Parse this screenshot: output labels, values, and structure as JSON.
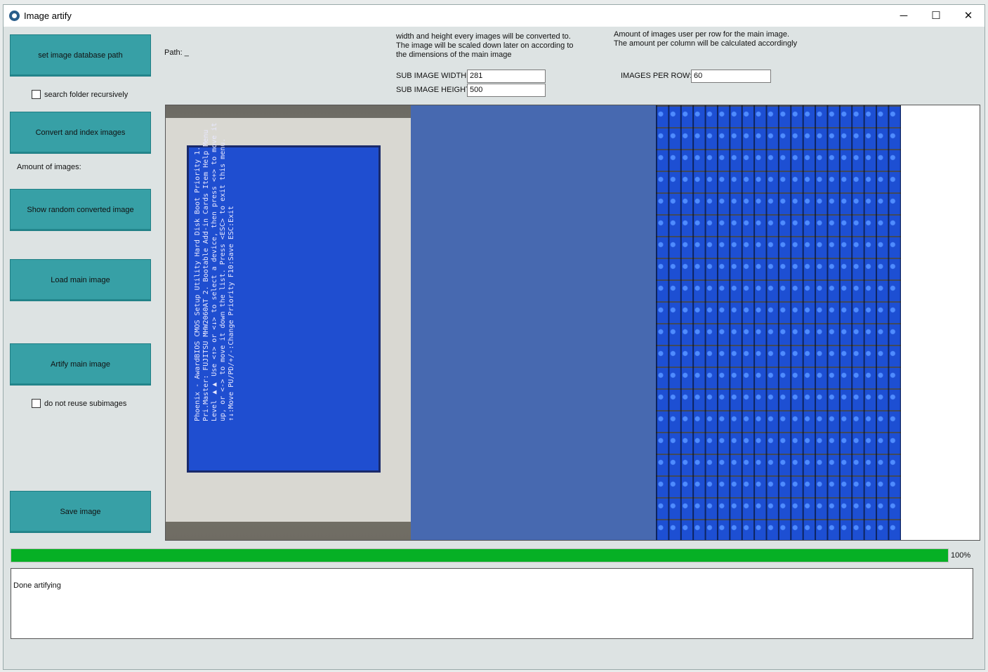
{
  "window": {
    "title": "Image artify",
    "minimize_glyph": "─",
    "maximize_glyph": "☐",
    "close_glyph": "✕"
  },
  "sidebar": {
    "set_path_button": "set image database path",
    "search_recursive_label": "search folder recursively",
    "search_recursive_checked": false,
    "convert_button": "Convert and index images",
    "amount_label": "Amount of images:",
    "show_random_button": "Show random converted image",
    "load_main_button": "Load main image",
    "artify_button": "Artify main image",
    "no_reuse_label": "do not reuse subimages",
    "no_reuse_checked": false,
    "save_button": "Save image"
  },
  "settings": {
    "path_label": "Path: _",
    "size_info_line1": "width and height every images will be converted to.",
    "size_info_line2": "The image will be scaled down later on according to",
    "size_info_line3": "the dimensions of the main image",
    "sub_width_label": "SUB IMAGE WIDTH:",
    "sub_width_value": "281",
    "sub_height_label": "SUB IMAGE HEIGHT:",
    "sub_height_value": "500",
    "row_info_line1": "Amount of images user per row for the main image.",
    "row_info_line2": "The amount per column will be calculated accordingly",
    "images_per_row_label": "IMAGES PER ROW:",
    "images_per_row_value": "60"
  },
  "preview": {
    "bios_text": "Phoenix - AwardBIOS CMOS Setup Utility\nHard Disk Boot Priority\n1. Pri.Master: FUJITSU MHW2060AT\n2. Bootable Add-in Cards\nItem Help\nMenu Level ▶▶\nUse <↑> or <↓> to select a device, then press <+> to move it up, or <-> to move it down the list. Press <ESC> to exit this menu.\n↑↓:Move  PU/PD/+/-:Change Priority  F10:Save  ESC:Exit"
  },
  "progress": {
    "value": 1.0,
    "label": "100%"
  },
  "log": {
    "text": "Done artifying"
  },
  "colors": {
    "button_bg": "#37a0a6",
    "progress_green": "#06b025",
    "window_bg": "#dde3e3"
  }
}
